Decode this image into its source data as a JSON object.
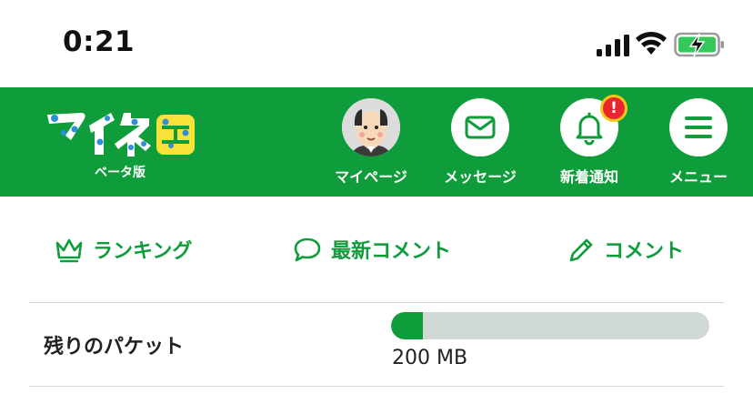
{
  "status_bar": {
    "time": "0:21"
  },
  "header": {
    "logo_text": "マイネ王",
    "logo_sub": "ベータ版",
    "nav": [
      {
        "label": "マイページ",
        "icon": "avatar"
      },
      {
        "label": "メッセージ",
        "icon": "mail-icon"
      },
      {
        "label": "新着通知",
        "icon": "bell-icon",
        "badge": "!"
      },
      {
        "label": "メニュー",
        "icon": "menu-icon"
      }
    ]
  },
  "tabs": [
    {
      "label": "ランキング",
      "icon": "crown-icon"
    },
    {
      "label": "最新コメント",
      "icon": "speech-bubble-icon"
    },
    {
      "label": "コメント",
      "icon": "pencil-icon"
    }
  ],
  "packet": {
    "label": "残りのパケット",
    "value": "200 MB",
    "fill_fraction": 0.1
  },
  "colors": {
    "brand_green": "#0f9d3b",
    "bar_track": "#d1d9d5",
    "badge_red": "#e8262d",
    "badge_ring": "#f5c518"
  }
}
